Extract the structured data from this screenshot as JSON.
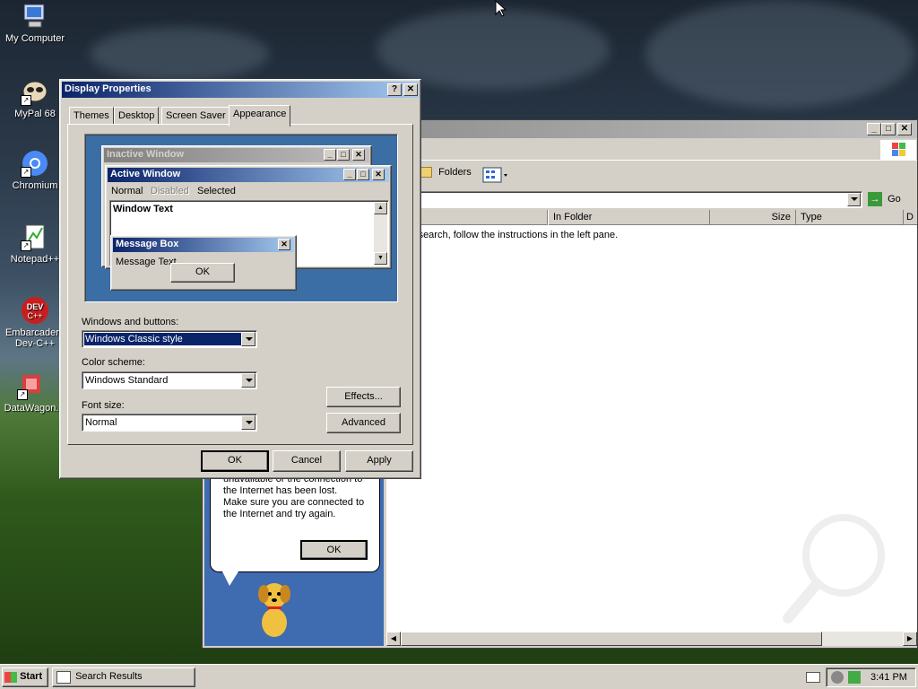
{
  "desktop": {
    "icons": [
      {
        "label": "My Computer"
      },
      {
        "label": "MyPal 68"
      },
      {
        "label": "Chromium"
      },
      {
        "label": "Notepad++"
      },
      {
        "label": "Embarcadero Dev-C++"
      },
      {
        "label": "DataWagon."
      }
    ]
  },
  "search_window": {
    "toolbar": {
      "folders_label": "Folders",
      "go_label": "Go"
    },
    "columns": [
      "In Folder",
      "Size",
      "Type",
      "D"
    ],
    "message": "t your search, follow the instructions in the left pane.",
    "balloon": {
      "text_lines": [
        "unavailable or the connection to",
        "the Internet has been lost.",
        "Make sure you are connected to",
        "the Internet and try again."
      ],
      "ok_label": "OK"
    }
  },
  "dialog": {
    "title": "Display Properties",
    "tabs": [
      "Themes",
      "Desktop",
      "Screen Saver",
      "Appearance"
    ],
    "active_tab": "Appearance",
    "preview": {
      "inactive_title": "Inactive Window",
      "active_title": "Active Window",
      "menu": [
        "Normal",
        "Disabled",
        "Selected"
      ],
      "window_text": "Window Text",
      "msgbox_title": "Message Box",
      "msgbox_text": "Message Text",
      "msgbox_ok": "OK"
    },
    "windows_buttons": {
      "label": "Windows and buttons:",
      "value": "Windows Classic style"
    },
    "color_scheme": {
      "label": "Color scheme:",
      "value": "Windows Standard"
    },
    "font_size": {
      "label": "Font size:",
      "value": "Normal"
    },
    "effects_label": "Effects...",
    "advanced_label": "Advanced",
    "ok_label": "OK",
    "cancel_label": "Cancel",
    "apply_label": "Apply"
  },
  "taskbar": {
    "start_label": "Start",
    "task_label": "Search Results",
    "clock": "3:41 PM"
  }
}
